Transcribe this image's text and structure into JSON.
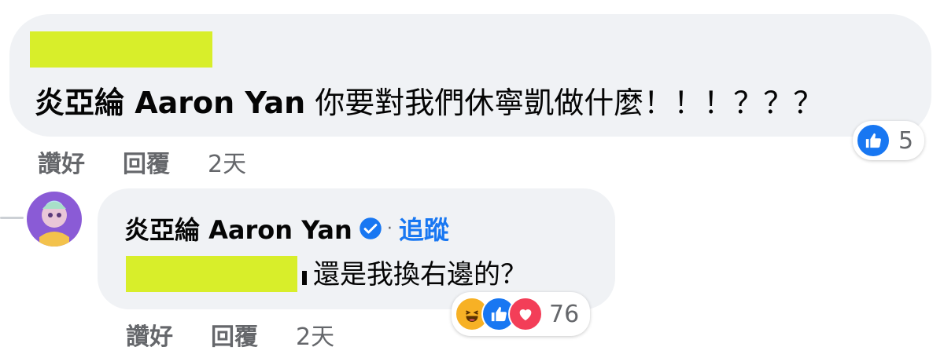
{
  "comment1": {
    "author": "炎亞綸 Aaron Yan",
    "text": "你要對我們休寧凱做什麼！！！？？？",
    "actions": {
      "like": "讚好",
      "reply": "回覆",
      "time": "2天"
    },
    "reactions": {
      "types": [
        "like-icon"
      ],
      "count": "5"
    }
  },
  "reply1": {
    "author": "炎亞綸 Aaron Yan",
    "verified_icon": "verified-icon",
    "separator": "·",
    "follow": "追蹤",
    "text": "還是我換右邊的？",
    "actions": {
      "like": "讚好",
      "reply": "回覆",
      "time": "2天"
    },
    "reactions": {
      "types": [
        "haha-icon",
        "like-icon",
        "love-icon"
      ],
      "count": "76"
    }
  },
  "colors": {
    "accent": "#1877f2",
    "bubble": "#f0f2f5",
    "muted": "#65676b",
    "redaction": "#d8ee2a"
  }
}
